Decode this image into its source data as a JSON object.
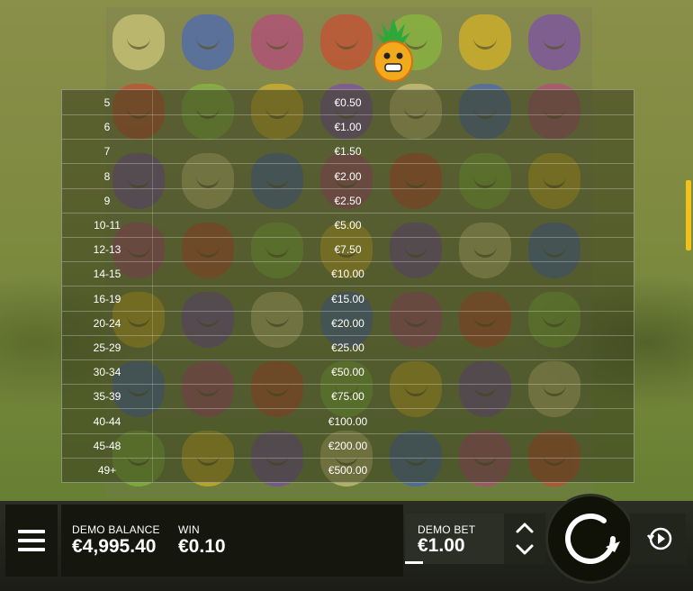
{
  "paytable": {
    "rows": [
      {
        "count": "5",
        "payout": "€0.50"
      },
      {
        "count": "6",
        "payout": "€1.00"
      },
      {
        "count": "7",
        "payout": "€1.50"
      },
      {
        "count": "8",
        "payout": "€2.00"
      },
      {
        "count": "9",
        "payout": "€2.50"
      },
      {
        "count": "10-11",
        "payout": "€5.00"
      },
      {
        "count": "12-13",
        "payout": "€7.50"
      },
      {
        "count": "14-15",
        "payout": "€10.00"
      },
      {
        "count": "16-19",
        "payout": "€15.00"
      },
      {
        "count": "20-24",
        "payout": "€20.00"
      },
      {
        "count": "25-29",
        "payout": "€25.00"
      },
      {
        "count": "30-34",
        "payout": "€50.00"
      },
      {
        "count": "35-39",
        "payout": "€75.00"
      },
      {
        "count": "40-44",
        "payout": "€100.00"
      },
      {
        "count": "45-48",
        "payout": "€200.00"
      },
      {
        "count": "49+",
        "payout": "€500.00"
      }
    ]
  },
  "footer": {
    "balance_label": "DEMO BALANCE",
    "balance_value": "€4,995.40",
    "win_label": "WIN",
    "win_value": "€0.10",
    "bet_label": "DEMO BET",
    "bet_value": "€1.00"
  },
  "icons": {
    "menu": "hamburger-menu-icon",
    "bet_up": "chevron-up-icon",
    "bet_down": "chevron-down-icon",
    "spin": "spin-arrow-icon",
    "autoplay": "autoplay-icon",
    "mascot": "pineapple-mascot-icon"
  },
  "colors": {
    "accent": "#f0c21a",
    "panel": "#15170f",
    "text": "#ffffff"
  }
}
